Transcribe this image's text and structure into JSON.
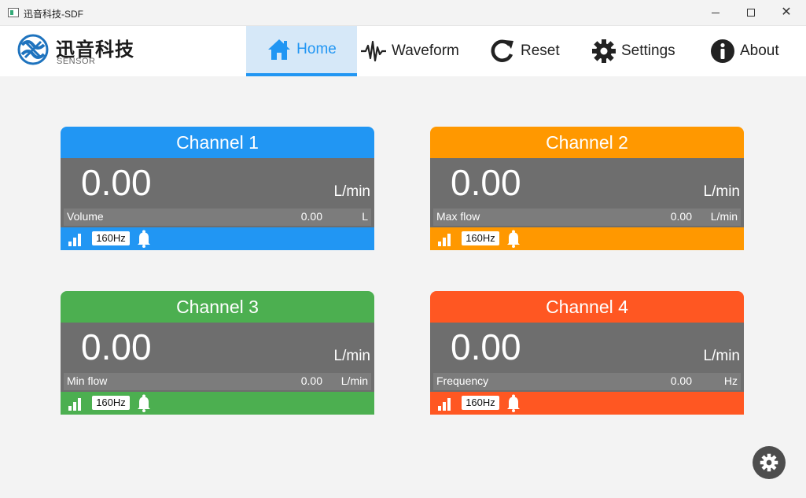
{
  "window": {
    "title": "迅音科技-SDF",
    "minimize": "minimize",
    "maximize": "maximize",
    "close": "✕"
  },
  "brand": {
    "name": "迅音科技",
    "sub": "SENSOR"
  },
  "nav": {
    "home": "Home",
    "waveform": "Waveform",
    "reset": "Reset",
    "settings": "Settings",
    "about": "About"
  },
  "colors": {
    "accent": "#2196f3",
    "channel1": "#2196f3",
    "channel2": "#ff9800",
    "channel3": "#4caf50",
    "channel4": "#ff5722",
    "body": "#6e6e6e"
  },
  "channels": [
    {
      "title": "Channel 1",
      "value": "0.00",
      "unit": "L/min",
      "sub_label": "Volume",
      "sub_value": "0.00",
      "sub_unit": "L",
      "freq": "160Hz"
    },
    {
      "title": "Channel 2",
      "value": "0.00",
      "unit": "L/min",
      "sub_label": "Max flow",
      "sub_value": "0.00",
      "sub_unit": "L/min",
      "freq": "160Hz"
    },
    {
      "title": "Channel 3",
      "value": "0.00",
      "unit": "L/min",
      "sub_label": "Min flow",
      "sub_value": "0.00",
      "sub_unit": "L/min",
      "freq": "160Hz"
    },
    {
      "title": "Channel 4",
      "value": "0.00",
      "unit": "L/min",
      "sub_label": "Frequency",
      "sub_value": "0.00",
      "sub_unit": "Hz",
      "freq": "160Hz"
    }
  ],
  "icons": {
    "home": "home-icon",
    "waveform": "waveform-icon",
    "reset": "reset-icon",
    "settings": "gear-icon",
    "about": "info-icon",
    "signal": "signal-icon",
    "bell": "bell-icon",
    "fab": "gear-icon"
  }
}
